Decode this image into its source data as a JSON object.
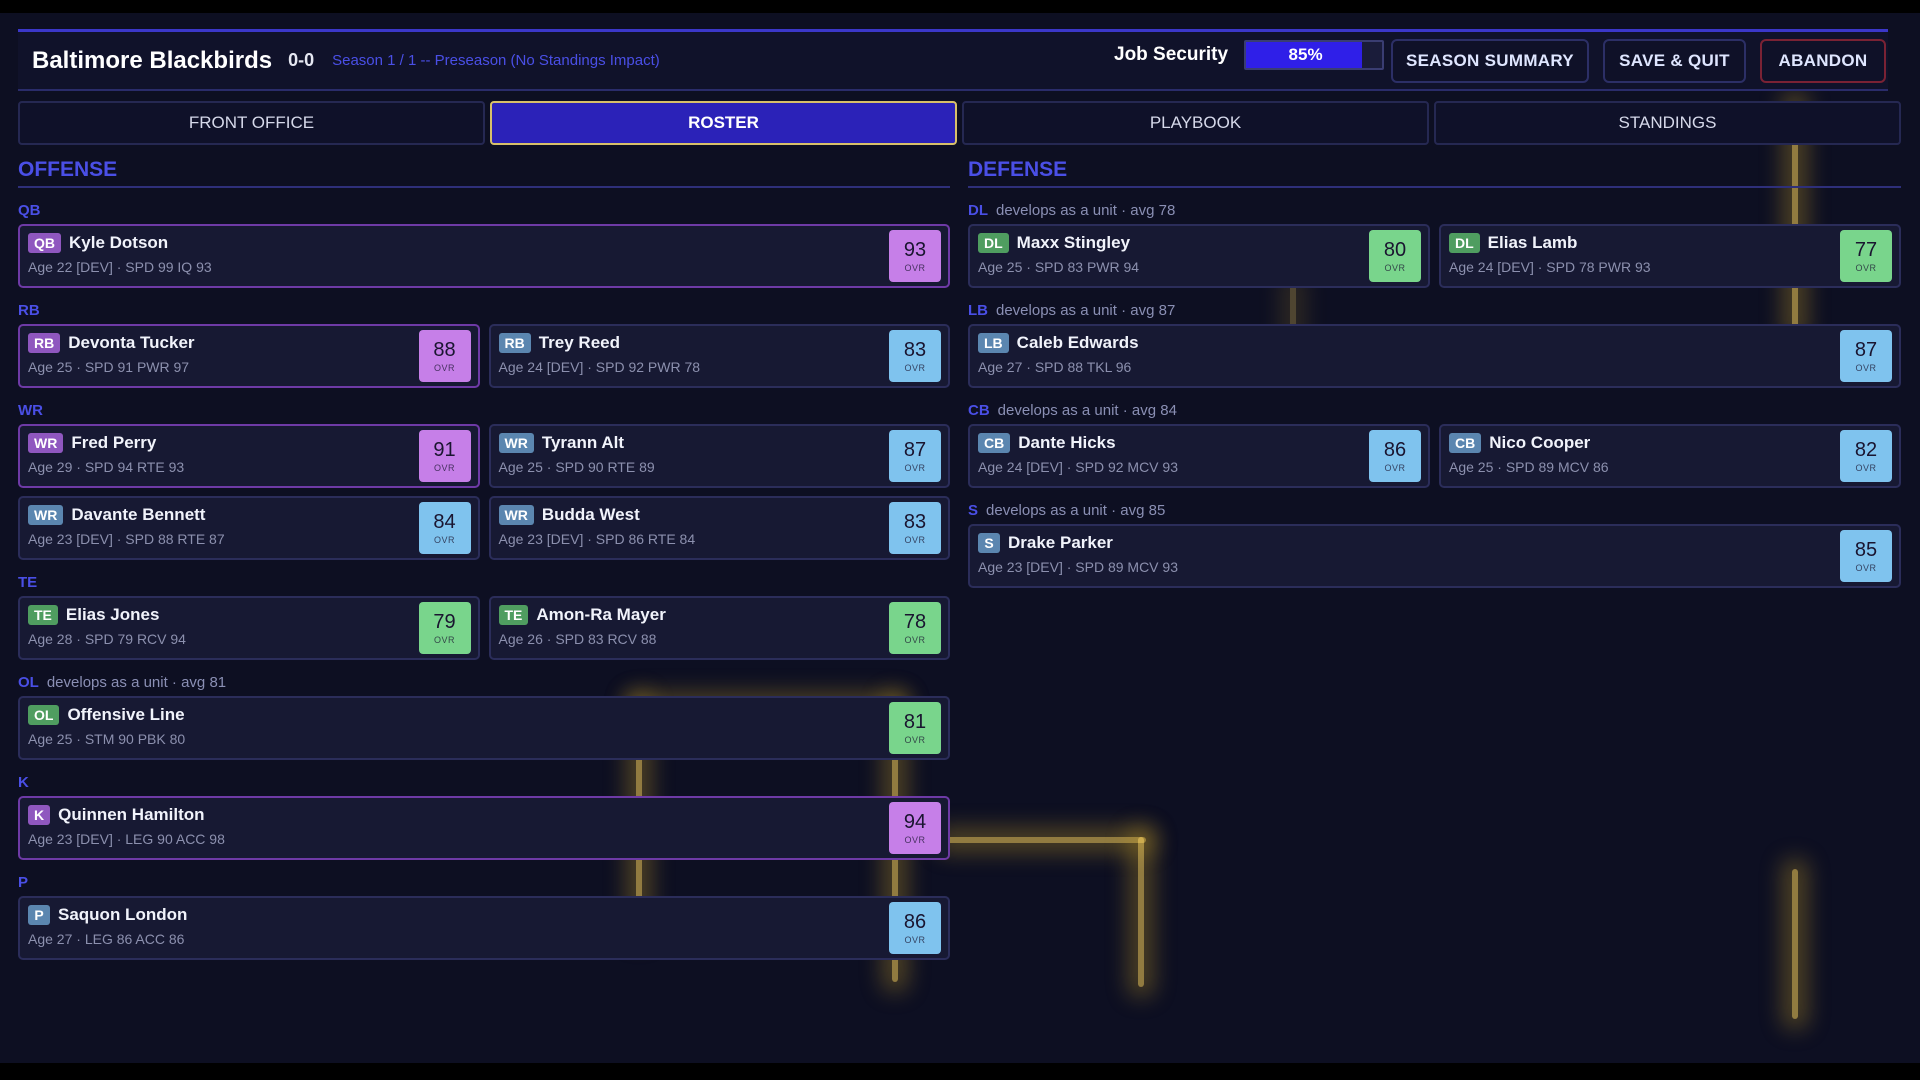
{
  "header": {
    "team_name": "Baltimore Blackbirds",
    "record": "0-0",
    "season_info": "Season 1 / 1 -- Preseason (No Standings Impact)",
    "job_security_label": "Job Security",
    "job_security_value": "85%",
    "job_security_fraction": 0.85,
    "buttons": {
      "season_summary": "SEASON SUMMARY",
      "save_quit": "SAVE & QUIT",
      "abandon": "ABANDON"
    }
  },
  "tabs": [
    {
      "label": "FRONT OFFICE",
      "active": false
    },
    {
      "label": "ROSTER",
      "active": true
    },
    {
      "label": "PLAYBOOK",
      "active": false
    },
    {
      "label": "STANDINGS",
      "active": false
    }
  ],
  "offense": {
    "title": "OFFENSE",
    "groups": [
      {
        "pos": "QB",
        "note": "",
        "rows": [
          [
            {
              "badge": "QB",
              "name": "Kyle Dotson",
              "info": "Age 22 [DEV]  ·  SPD 99  IQ 93",
              "ovr": "93",
              "ovr_label": "OVR",
              "color": "purple"
            }
          ]
        ]
      },
      {
        "pos": "RB",
        "note": "",
        "rows": [
          [
            {
              "badge": "RB",
              "name": "Devonta Tucker",
              "info": "Age 25  ·  SPD 91  PWR 97",
              "ovr": "88",
              "ovr_label": "OVR",
              "color": "purple"
            },
            {
              "badge": "RB",
              "name": "Trey Reed",
              "info": "Age 24 [DEV]  ·  SPD 92  PWR 78",
              "ovr": "83",
              "ovr_label": "OVR",
              "color": "blue"
            }
          ]
        ]
      },
      {
        "pos": "WR",
        "note": "",
        "rows": [
          [
            {
              "badge": "WR",
              "name": "Fred Perry",
              "info": "Age 29  ·  SPD 94  RTE 93",
              "ovr": "91",
              "ovr_label": "OVR",
              "color": "purple"
            },
            {
              "badge": "WR",
              "name": "Tyrann Alt",
              "info": "Age 25  ·  SPD 90  RTE 89",
              "ovr": "87",
              "ovr_label": "OVR",
              "color": "blue"
            }
          ],
          [
            {
              "badge": "WR",
              "name": "Davante Bennett",
              "info": "Age 23 [DEV]  ·  SPD 88  RTE 87",
              "ovr": "84",
              "ovr_label": "OVR",
              "color": "blue"
            },
            {
              "badge": "WR",
              "name": "Budda West",
              "info": "Age 23 [DEV]  ·  SPD 86  RTE 84",
              "ovr": "83",
              "ovr_label": "OVR",
              "color": "blue"
            }
          ]
        ]
      },
      {
        "pos": "TE",
        "note": "",
        "rows": [
          [
            {
              "badge": "TE",
              "name": "Elias Jones",
              "info": "Age 28  ·  SPD 79  RCV 94",
              "ovr": "79",
              "ovr_label": "OVR",
              "color": "green"
            },
            {
              "badge": "TE",
              "name": "Amon-Ra Mayer",
              "info": "Age 26  ·  SPD 83  RCV 88",
              "ovr": "78",
              "ovr_label": "OVR",
              "color": "green"
            }
          ]
        ]
      },
      {
        "pos": "OL",
        "note": "develops as a unit  ·  avg 81",
        "rows": [
          [
            {
              "badge": "OL",
              "name": "Offensive Line",
              "info": "Age 25  ·  STM 90  PBK 80",
              "ovr": "81",
              "ovr_label": "OVR",
              "color": "green"
            }
          ]
        ]
      },
      {
        "pos": "K",
        "note": "",
        "rows": [
          [
            {
              "badge": "K",
              "name": "Quinnen Hamilton",
              "info": "Age 23 [DEV]  ·  LEG 90  ACC 98",
              "ovr": "94",
              "ovr_label": "OVR",
              "color": "purple"
            }
          ]
        ]
      },
      {
        "pos": "P",
        "note": "",
        "rows": [
          [
            {
              "badge": "P",
              "name": "Saquon London",
              "info": "Age 27  ·  LEG 86  ACC 86",
              "ovr": "86",
              "ovr_label": "OVR",
              "color": "blue"
            }
          ]
        ]
      }
    ]
  },
  "defense": {
    "title": "DEFENSE",
    "groups": [
      {
        "pos": "DL",
        "note": "develops as a unit  ·  avg 78",
        "rows": [
          [
            {
              "badge": "DL",
              "name": "Maxx Stingley",
              "info": "Age 25  ·  SPD 83  PWR 94",
              "ovr": "80",
              "ovr_label": "OVR",
              "color": "green"
            },
            {
              "badge": "DL",
              "name": "Elias Lamb",
              "info": "Age 24 [DEV]  ·  SPD 78  PWR 93",
              "ovr": "77",
              "ovr_label": "OVR",
              "color": "green"
            }
          ]
        ]
      },
      {
        "pos": "LB",
        "note": "develops as a unit  ·  avg 87",
        "rows": [
          [
            {
              "badge": "LB",
              "name": "Caleb Edwards",
              "info": "Age 27  ·  SPD 88  TKL 96",
              "ovr": "87",
              "ovr_label": "OVR",
              "color": "blue"
            }
          ]
        ]
      },
      {
        "pos": "CB",
        "note": "develops as a unit  ·  avg 84",
        "rows": [
          [
            {
              "badge": "CB",
              "name": "Dante Hicks",
              "info": "Age 24 [DEV]  ·  SPD 92  MCV 93",
              "ovr": "86",
              "ovr_label": "OVR",
              "color": "blue"
            },
            {
              "badge": "CB",
              "name": "Nico Cooper",
              "info": "Age 25  ·  SPD 89  MCV 86",
              "ovr": "82",
              "ovr_label": "OVR",
              "color": "blue"
            }
          ]
        ]
      },
      {
        "pos": "S",
        "note": "develops as a unit  ·  avg 85",
        "rows": [
          [
            {
              "badge": "S",
              "name": "Drake Parker",
              "info": "Age 23 [DEV]  ·  SPD 89  MCV 93",
              "ovr": "85",
              "ovr_label": "OVR",
              "color": "blue"
            }
          ]
        ]
      }
    ]
  }
}
